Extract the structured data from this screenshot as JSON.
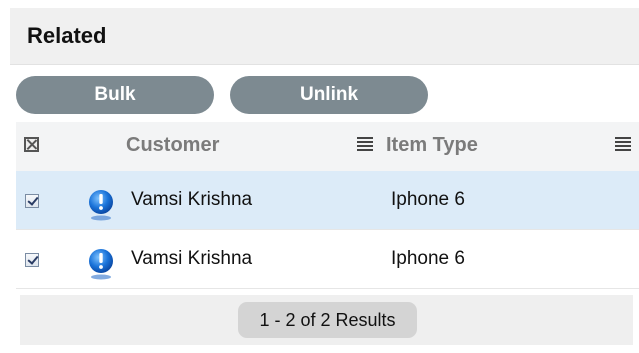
{
  "panel": {
    "title": "Related"
  },
  "toolbar": {
    "bulk_label": "Bulk",
    "unlink_label": "Unlink"
  },
  "table": {
    "columns": [
      {
        "label": "Customer"
      },
      {
        "label": "Item Type"
      }
    ],
    "rows": [
      {
        "checked": true,
        "customer": "Vamsi Krishna",
        "item_type": "Iphone 6"
      },
      {
        "checked": true,
        "customer": "Vamsi Krishna",
        "item_type": "Iphone 6"
      }
    ]
  },
  "pagination": {
    "summary": "1 - 2 of 2 Results"
  },
  "colors": {
    "button_bg": "#7d8a91",
    "selected_row_bg": "#dcebf8",
    "header_bg": "#f0f0f0",
    "info_icon_blue": "#1a73d9"
  },
  "icons": {
    "select_all": "deselect-all-icon",
    "row_status": "info-icon",
    "column_menu": "column-menu-icon"
  }
}
